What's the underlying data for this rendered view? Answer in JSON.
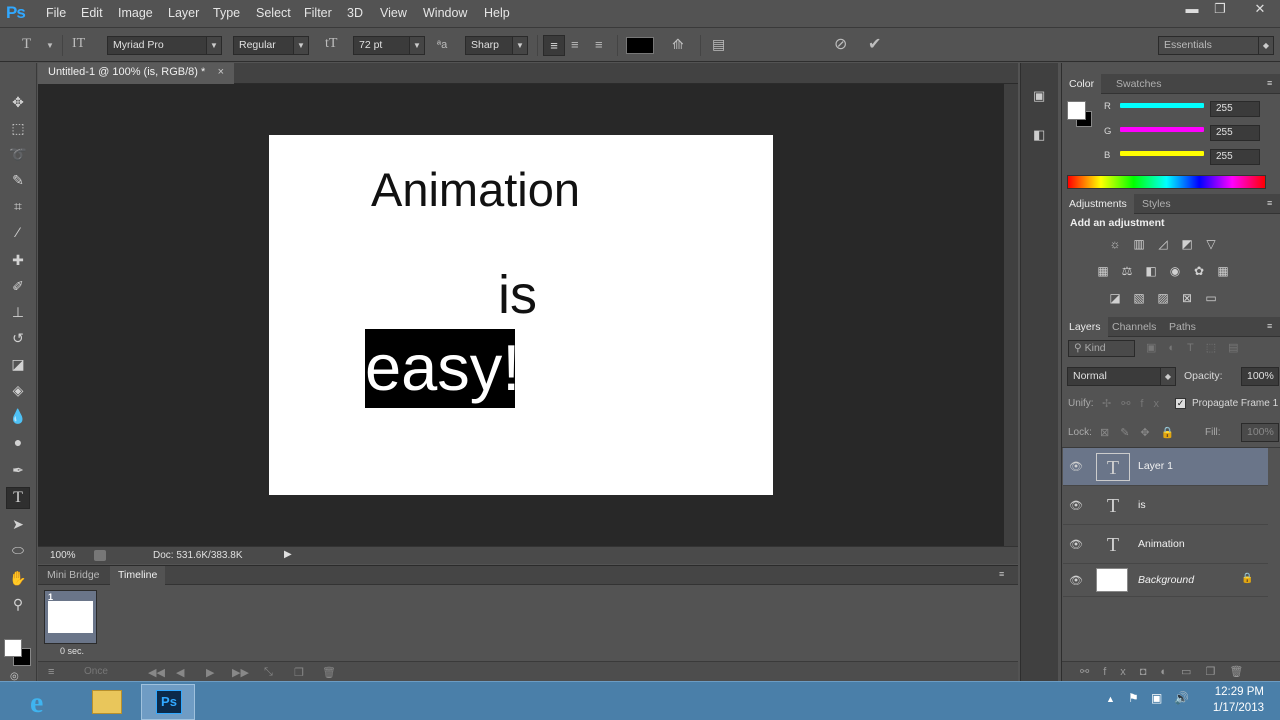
{
  "app": {
    "logo": "Ps"
  },
  "menu": [
    "File",
    "Edit",
    "Image",
    "Layer",
    "Type",
    "Select",
    "Filter",
    "3D",
    "View",
    "Window",
    "Help"
  ],
  "window_controls": {
    "minimize": "▬",
    "restore": "❐",
    "close": "✕"
  },
  "options_bar": {
    "font_family": "Myriad Pro",
    "font_style": "Regular",
    "font_size": "72 pt",
    "antialias": "Sharp",
    "text_color": "#000000",
    "workspace": "Essentials"
  },
  "document": {
    "tab_title": "Untitled-1 @ 100% (is, RGB/8) *",
    "tab_close": "×",
    "zoom": "100%",
    "doc_info": "Doc: 531.6K/383.8K",
    "canvas_text": {
      "line1": "Animation",
      "line2": "is",
      "line3": "easy!"
    }
  },
  "timeline": {
    "tabs": [
      "Mini Bridge",
      "Timeline"
    ],
    "frame_number": "1",
    "frame_delay": "0 sec.",
    "loop": "Once"
  },
  "color_panel": {
    "tabs": [
      "Color",
      "Swatches"
    ],
    "channels": [
      {
        "label": "R",
        "value": "255",
        "color": "#00ffff"
      },
      {
        "label": "G",
        "value": "255",
        "color": "#ff00ff"
      },
      {
        "label": "B",
        "value": "255",
        "color": "#ffff00"
      }
    ]
  },
  "adjustments_panel": {
    "tabs": [
      "Adjustments",
      "Styles"
    ],
    "heading": "Add an adjustment"
  },
  "layers_panel": {
    "tabs": [
      "Layers",
      "Channels",
      "Paths"
    ],
    "filter": "Kind",
    "blend_mode": "Normal",
    "opacity_label": "Opacity:",
    "opacity": "100%",
    "unify_label": "Unify:",
    "propagate_label": "Propagate Frame 1",
    "lock_label": "Lock:",
    "fill_label": "Fill:",
    "fill": "100%",
    "layers": [
      {
        "name": "Layer 1",
        "type": "text",
        "selected": true
      },
      {
        "name": "is",
        "type": "text",
        "selected": false
      },
      {
        "name": "Animation",
        "type": "text",
        "selected": false
      },
      {
        "name": "Background",
        "type": "image",
        "selected": false,
        "locked": true
      }
    ]
  },
  "taskbar": {
    "time": "12:29 PM",
    "date": "1/17/2013",
    "ps_label": "Ps"
  }
}
